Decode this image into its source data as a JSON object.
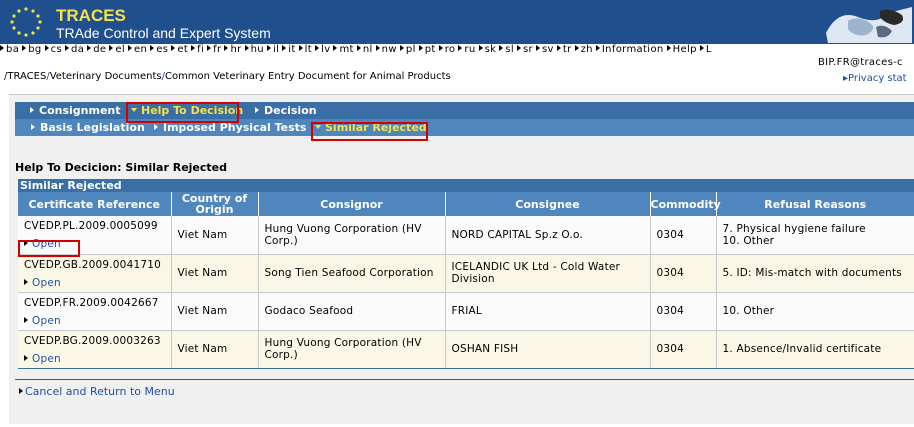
{
  "header": {
    "brand": "TRACES",
    "subtitle": "TRAde Control and Expert System"
  },
  "languages": [
    "ba",
    "bg",
    "cs",
    "da",
    "de",
    "el",
    "en",
    "es",
    "et",
    "fi",
    "fr",
    "hr",
    "hu",
    "il",
    "it",
    "lt",
    "lv",
    "mt",
    "nl",
    "nw",
    "pl",
    "pt",
    "ro",
    "ru",
    "sk",
    "sl",
    "sr",
    "sv",
    "tr",
    "zh",
    "Information",
    "Help",
    "L"
  ],
  "user": "BIP.FR@traces-c",
  "breadcrumb": {
    "root": "/TRACES",
    "section": "Veterinary Documents",
    "page": "Common Veterinary Entry Document for Animal Products"
  },
  "privacy": "Privacy stat",
  "tabs_primary": [
    {
      "label": "Consignment"
    },
    {
      "label": "Help To Decision"
    },
    {
      "label": "Decision"
    }
  ],
  "tabs_secondary": [
    {
      "label": "Basis Legislation"
    },
    {
      "label": "Imposed Physical Tests"
    },
    {
      "label": "Similar Rejected"
    }
  ],
  "page_heading": "Help To Decicion: Similar Rejected",
  "table": {
    "title": "Similar Rejected",
    "columns": [
      "Certificate Reference",
      "Country of Origin",
      "Consignor",
      "Consignee",
      "Commodity",
      "Refusal Reasons"
    ],
    "open_label": "Open",
    "rows": [
      {
        "cert": "CVEDP.PL.2009.0005099",
        "country": "Viet Nam",
        "consignor": "Hung Vuong Corporation (HV Corp.)",
        "consignee": "NORD CAPITAL Sp.z O.o.",
        "commodity": "0304",
        "reasons": "7. Physical hygiene failure\n10. Other"
      },
      {
        "cert": "CVEDP.GB.2009.0041710",
        "country": "Viet Nam",
        "consignor": "Song Tien Seafood Corporation",
        "consignee": "ICELANDIC UK Ltd - Cold Water Division",
        "commodity": "0304",
        "reasons": "5. ID: Mis-match with documents"
      },
      {
        "cert": "CVEDP.FR.2009.0042667",
        "country": "Viet Nam",
        "consignor": "Godaco Seafood",
        "consignee": "FRIAL",
        "commodity": "0304",
        "reasons": "10. Other"
      },
      {
        "cert": "CVEDP.BG.2009.0003263",
        "country": "Viet Nam",
        "consignor": "Hung Vuong Corporation (HV Corp.)",
        "consignee": "OSHAN FISH",
        "commodity": "0304",
        "reasons": "1. Absence/Invalid certificate"
      }
    ]
  },
  "cancel_link": "Cancel and Return to Menu",
  "colors": {
    "banner": "#1f4f8c",
    "tab_primary": "#3a6fa5",
    "tab_secondary": "#4e86bd",
    "active_text": "#f5e04a",
    "highlight": "#d40000"
  }
}
